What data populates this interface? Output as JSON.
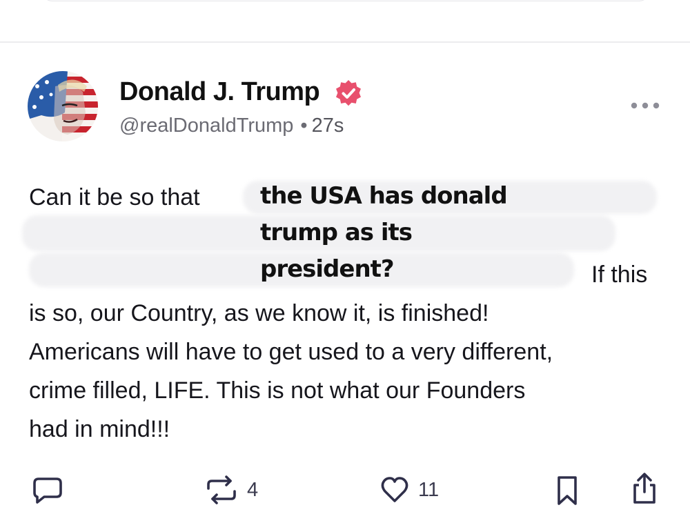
{
  "post": {
    "author_name": "Donald J. Trump",
    "handle": "@realDonaldTrump",
    "separator": "•",
    "time": "27s",
    "text_line1_start": "Can it be so that",
    "overlay_line1": "the USA has donald",
    "overlay_line2": "trump as its",
    "overlay_line3": "president?",
    "text_line3_end": "If this",
    "text_line4": "is so, our Country, as we know it, is finished!",
    "text_line5": "Americans will have to get used to a very different,",
    "text_line6": "crime filled, LIFE. This is not what our Founders",
    "text_line7": "had in mind!!!"
  },
  "actions": {
    "reposts": "4",
    "likes": "11"
  },
  "icons": {
    "verified": "verified-badge-icon",
    "more": "more-options-icon",
    "reply": "reply-icon",
    "repost": "repost-icon",
    "like": "heart-icon",
    "bookmark": "bookmark-icon",
    "share": "share-icon"
  },
  "colors": {
    "verified_badge": "#e8506d",
    "icon": "#2f2f4a",
    "handle": "#6b6b73"
  }
}
